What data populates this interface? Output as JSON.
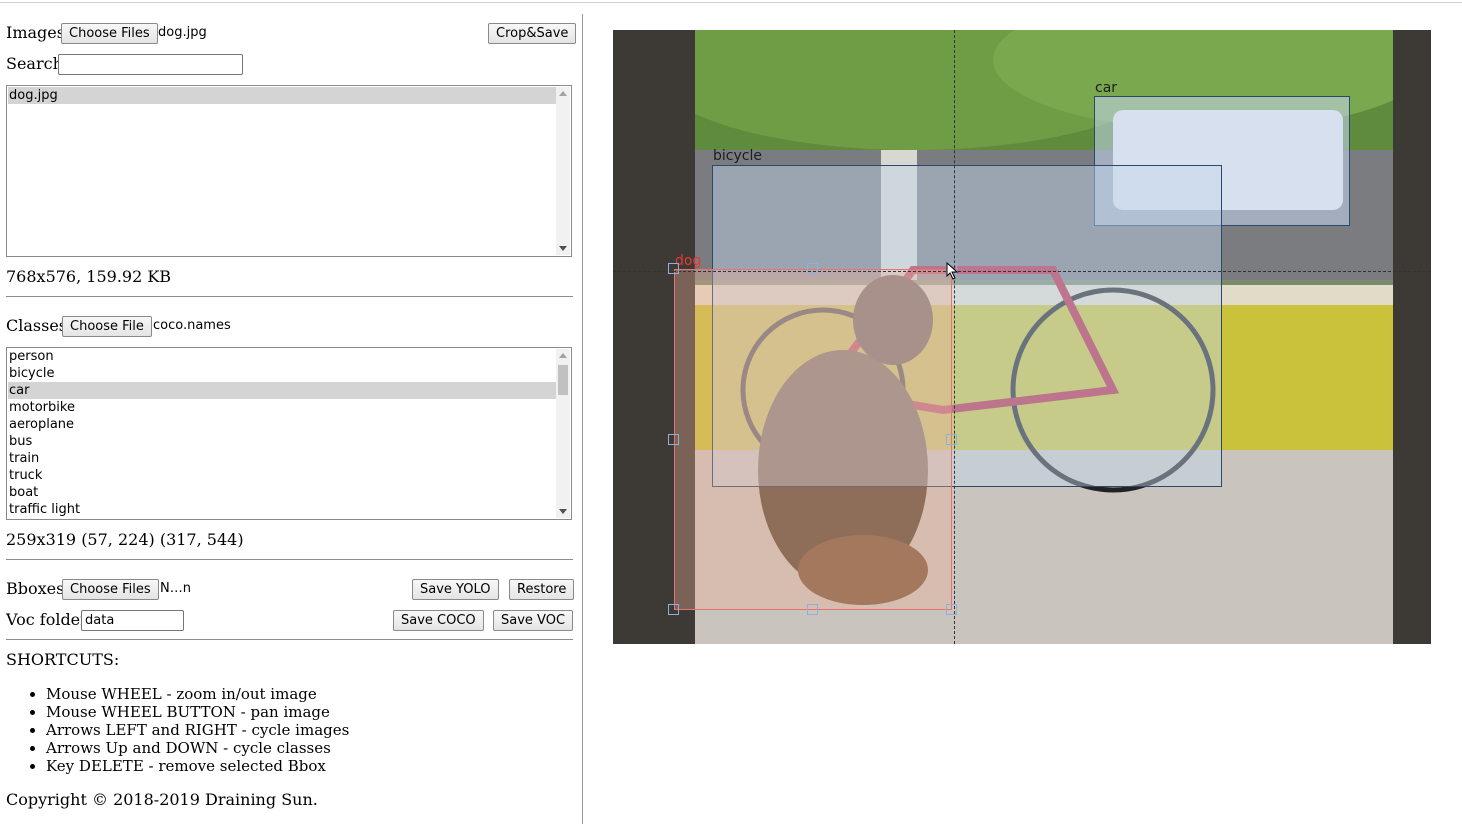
{
  "images": {
    "label": "Images:",
    "choose_label": "Choose Files",
    "filename": "dog.jpg",
    "crop_label": "Crop&Save"
  },
  "search": {
    "label": "Search:",
    "value": ""
  },
  "image_list": {
    "items": [
      "dog.jpg"
    ],
    "selected": "dog.jpg"
  },
  "image_info": "768x576, 159.92 KB",
  "classes": {
    "label": "Classes:",
    "choose_label": "Choose File",
    "filename": "coco.names",
    "items": [
      "person",
      "bicycle",
      "car",
      "motorbike",
      "aeroplane",
      "bus",
      "train",
      "truck",
      "boat",
      "traffic light"
    ],
    "selected": "car"
  },
  "bbox_info": "259x319 (57, 224) (317, 544)",
  "bboxes": {
    "label": "Bboxes:",
    "choose_label": "Choose Files",
    "filename": "N…n",
    "save_yolo_label": "Save YOLO",
    "restore_label": "Restore"
  },
  "voc": {
    "label": "Voc folder:",
    "value": "data",
    "save_coco_label": "Save COCO",
    "save_voc_label": "Save VOC"
  },
  "shortcuts": {
    "title": "SHORTCUTS:",
    "items": [
      "Mouse WHEEL - zoom in/out image",
      "Mouse WHEEL BUTTON - pan image",
      "Arrows LEFT and RIGHT - cycle images",
      "Arrows Up and DOWN - cycle classes",
      "Key DELETE - remove selected Bbox"
    ]
  },
  "copyright": "Copyright © 2018-2019 Draining Sun.",
  "canvas": {
    "labels": {
      "car": "car",
      "bicycle": "bicycle",
      "dog": "dog"
    },
    "colors": {
      "car_box": "#2a4a6b",
      "bicycle_box": "#2a4a6b",
      "dog_box": "#e57373",
      "dog_label": "#e53935",
      "handle": "#8fb1d9"
    }
  }
}
